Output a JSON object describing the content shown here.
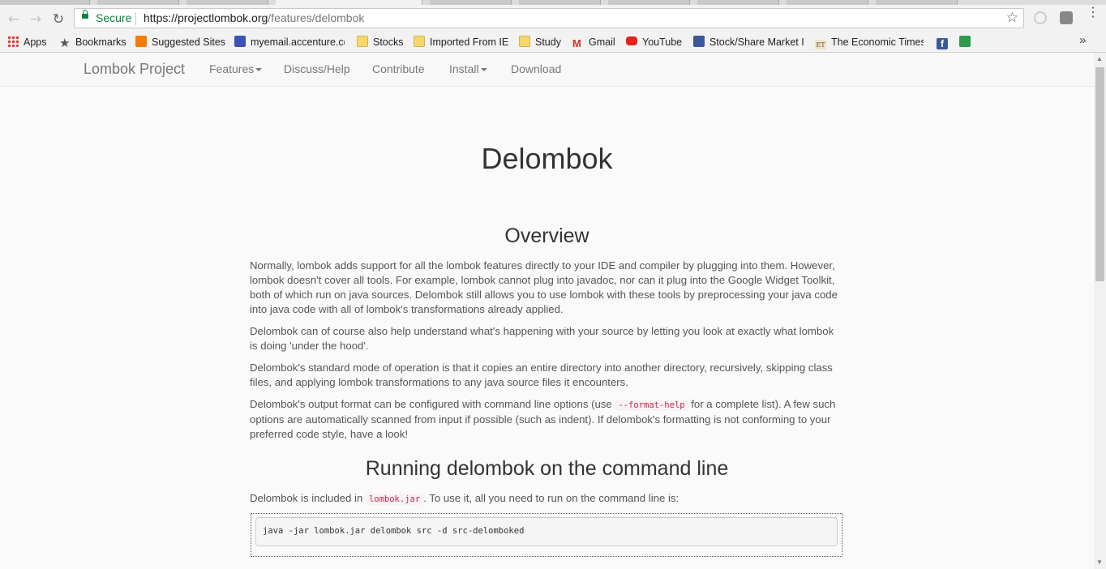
{
  "browser": {
    "omnibox": {
      "secure_label": "Secure",
      "url_host": "https://projectlombok.org",
      "url_path": "/features/delombok"
    },
    "bookmarks": [
      {
        "label": "Apps",
        "icon": "apps-grid-icon"
      },
      {
        "label": "Bookmarks",
        "icon": "star-icon"
      },
      {
        "label": "Suggested Sites",
        "icon": "suggested-sites-icon"
      },
      {
        "label": "myemail.accenture.cc",
        "icon": "email-icon"
      },
      {
        "label": "Stocks",
        "icon": "folder-icon"
      },
      {
        "label": "Imported From IE",
        "icon": "folder-icon"
      },
      {
        "label": "Study",
        "icon": "folder-icon"
      },
      {
        "label": "Gmail",
        "icon": "gmail-icon"
      },
      {
        "label": "YouTube",
        "icon": "youtube-icon"
      },
      {
        "label": "Stock/Share Market I",
        "icon": "stock-market-icon"
      },
      {
        "label": "The Economic Times",
        "icon": "et-icon"
      }
    ],
    "overflow_label": "»"
  },
  "site": {
    "brand": "Lombok Project",
    "nav": [
      {
        "label": "Features",
        "dropdown": true
      },
      {
        "label": "Discuss/Help",
        "dropdown": false
      },
      {
        "label": "Contribute",
        "dropdown": false
      },
      {
        "label": "Install",
        "dropdown": true
      },
      {
        "label": "Download",
        "dropdown": false
      }
    ]
  },
  "content": {
    "title": "Delombok",
    "overview_heading": "Overview",
    "p1": "Normally, lombok adds support for all the lombok features directly to your IDE and compiler by plugging into them. However, lombok doesn't cover all tools. For example, lombok cannot plug into javadoc, nor can it plug into the Google Widget Toolkit, both of which run on java sources. Delombok still allows you to use lombok with these tools by preprocessing your java code into java code with all of lombok's transformations already applied.",
    "p2": "Delombok can of course also help understand what's happening with your source by letting you look at exactly what lombok is doing 'under the hood'.",
    "p3": "Delombok's standard mode of operation is that it copies an entire directory into another directory, recursively, skipping class files, and applying lombok transformations to any java source files it encounters.",
    "p4_before": "Delombok's output format can be configured with command line options (use ",
    "p4_code": "--format-help",
    "p4_after": " for a complete list). A few such options are automatically scanned from input if possible (such as indent). If delombok's formatting is not conforming to your preferred code style, have a look!",
    "cmd_heading": "Running delombok on the command line",
    "p5_before": "Delombok is included in ",
    "p5_code": "lombok.jar",
    "p5_after": ". To use it, all you need to run on the command line is:",
    "command": "java -jar lombok.jar delombok src -d src-delomboked"
  },
  "colors": {
    "secure_green": "#0b8043",
    "code_pink": "#c7254e",
    "nav_gray": "#777777"
  }
}
